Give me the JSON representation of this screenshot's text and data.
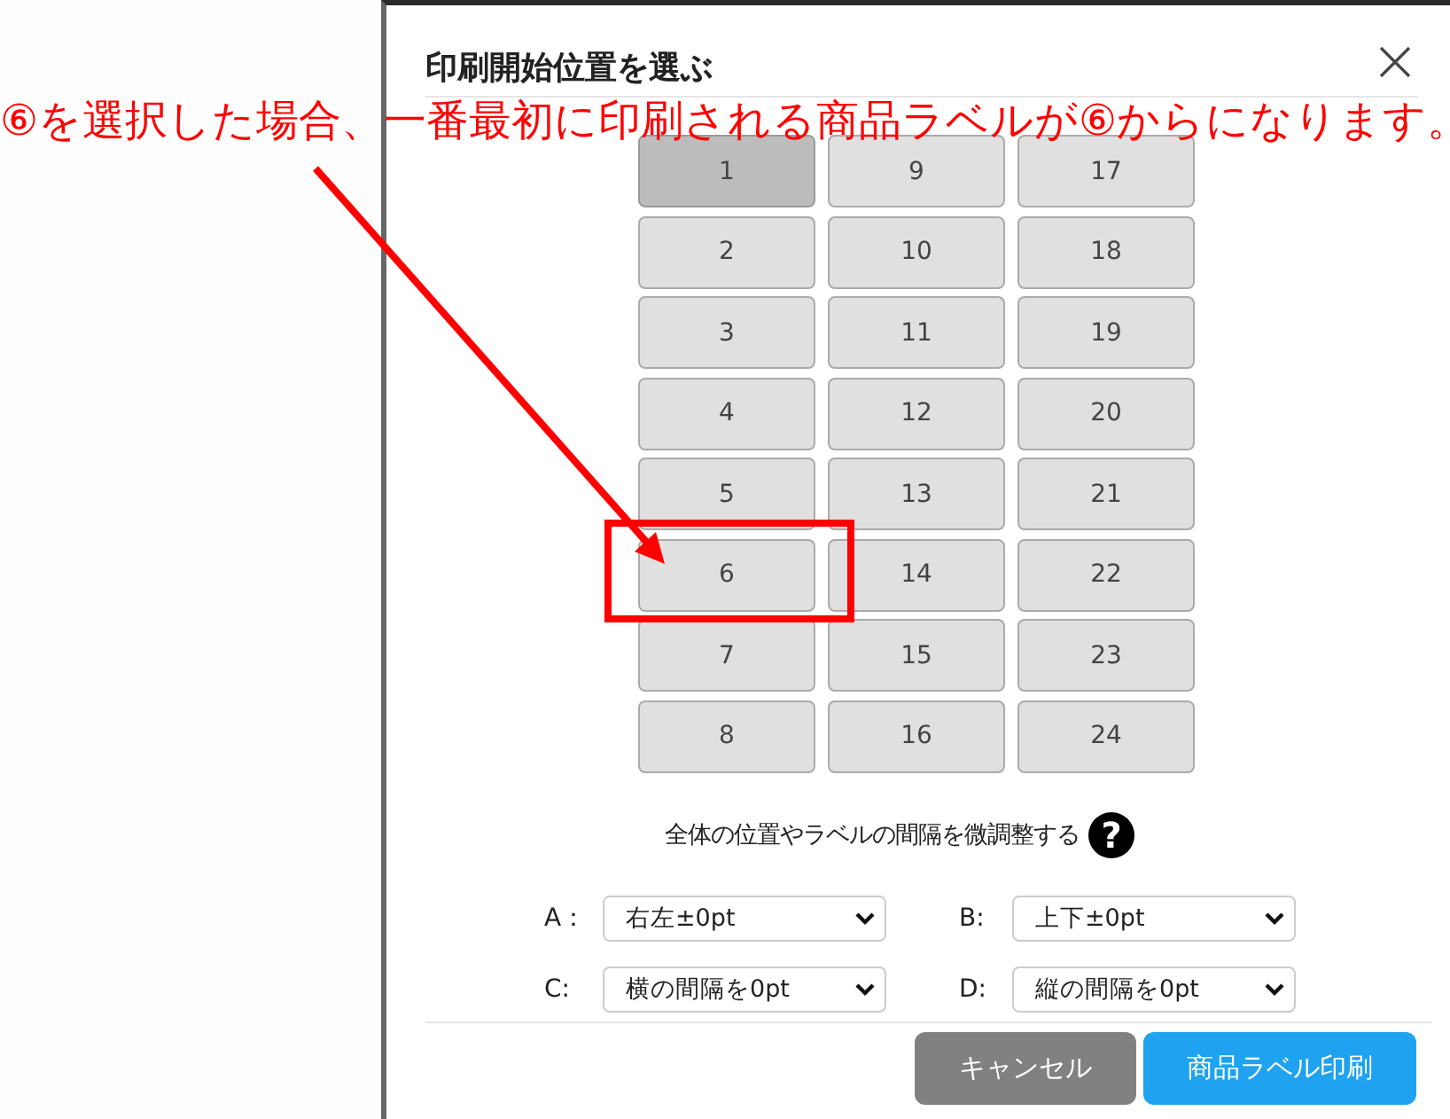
{
  "annotation": {
    "text": "⑥を選択した場合、一番最初に印刷される商品ラベルが⑥からになります。"
  },
  "dialog": {
    "title": "印刷開始位置を選ぶ"
  },
  "positions": [
    {
      "label": "1",
      "selected": true
    },
    {
      "label": "2",
      "selected": false
    },
    {
      "label": "3",
      "selected": false
    },
    {
      "label": "4",
      "selected": false
    },
    {
      "label": "5",
      "selected": false
    },
    {
      "label": "6",
      "selected": false
    },
    {
      "label": "7",
      "selected": false
    },
    {
      "label": "8",
      "selected": false
    },
    {
      "label": "9",
      "selected": false
    },
    {
      "label": "10",
      "selected": false
    },
    {
      "label": "11",
      "selected": false
    },
    {
      "label": "12",
      "selected": false
    },
    {
      "label": "13",
      "selected": false
    },
    {
      "label": "14",
      "selected": false
    },
    {
      "label": "15",
      "selected": false
    },
    {
      "label": "16",
      "selected": false
    },
    {
      "label": "17",
      "selected": false
    },
    {
      "label": "18",
      "selected": false
    },
    {
      "label": "19",
      "selected": false
    },
    {
      "label": "20",
      "selected": false
    },
    {
      "label": "21",
      "selected": false
    },
    {
      "label": "22",
      "selected": false
    },
    {
      "label": "23",
      "selected": false
    },
    {
      "label": "24",
      "selected": false
    }
  ],
  "fine_tune": {
    "text": "全体の位置やラベルの間隔を微調整する",
    "help": "?"
  },
  "offsets": [
    {
      "label": "A：",
      "value": "右左±0pt"
    },
    {
      "label": "B:",
      "value": "上下±0pt"
    },
    {
      "label": "C:",
      "value": "横の間隔を0pt"
    },
    {
      "label": "D:",
      "value": "縦の間隔を0pt"
    }
  ],
  "buttons": [
    {
      "label": "キャンセル",
      "kind": "secondary"
    },
    {
      "label": "商品ラベル印刷",
      "kind": "primary"
    }
  ]
}
